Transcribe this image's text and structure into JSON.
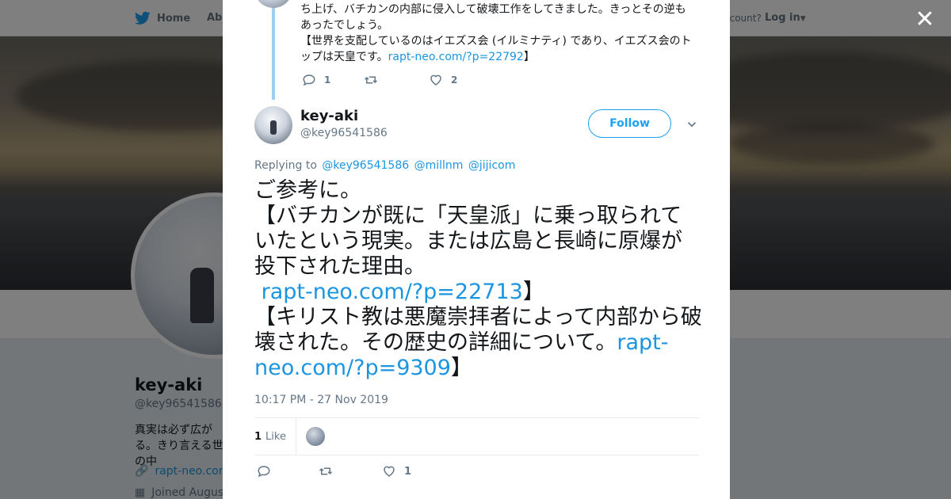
{
  "background": {
    "nav": {
      "home_label": "Home",
      "about_label": "Abo",
      "account_text": "ccount?",
      "login_label": "Log in"
    },
    "profile": {
      "name": "key-aki",
      "handle": "@key96541586",
      "bio": "真実は必ず広がる。きり言える世の中",
      "link": "rapt-neo.com",
      "joined": "Joined August"
    }
  },
  "modal": {
    "previous_tweet": {
      "text_line1": "ち上げ、バチカンの内部に侵入して破壊工作をしてきました。きっとその逆も",
      "text_line2": "あったでしょう。",
      "text_line3": "【世界を支配しているのはイエズス会 (イルミナティ) であり、イエズス会のト",
      "text_line4_prefix": "ップは天皇です。",
      "link": "rapt-neo.com/?p=22792",
      "text_line4_suffix": "】",
      "reply_count": "1",
      "retweet_count": "",
      "like_count": "2"
    },
    "tweet": {
      "author_name": "key-aki",
      "author_handle": "@key96541586",
      "follow_label": "Follow",
      "replying_label": "Replying to",
      "replying_to": [
        "@key96541586",
        "@millnm",
        "@jijicom"
      ],
      "text_part1": "ご参考に。",
      "text_part2": "【バチカンが既に「天皇派」に乗っ取られていたという現実。または広島と長崎に原爆が投下された理由。",
      "link1": "rapt-neo.com/?p=22713",
      "text_part3": "】",
      "text_part4": "【キリスト教は悪魔崇拝者によって内部から破壊された。その歴史の詳細について。",
      "link2": "rapt-neo.com/?p=9309",
      "text_part5": "】",
      "timestamp": "10:17 PM - 27 Nov 2019",
      "like_stat_count": "1",
      "like_stat_label": "Like",
      "reply_count": "",
      "retweet_count": "",
      "like_count": "1"
    }
  },
  "colors": {
    "link": "#1b95e0",
    "accent": "#1da1f2",
    "thread_line": "#9fd0f3",
    "muted": "#657786"
  },
  "icons": [
    "twitter-bird-icon",
    "close-icon",
    "reply-icon",
    "retweet-icon",
    "heart-icon",
    "chevron-down-icon",
    "link-icon",
    "calendar-icon"
  ]
}
